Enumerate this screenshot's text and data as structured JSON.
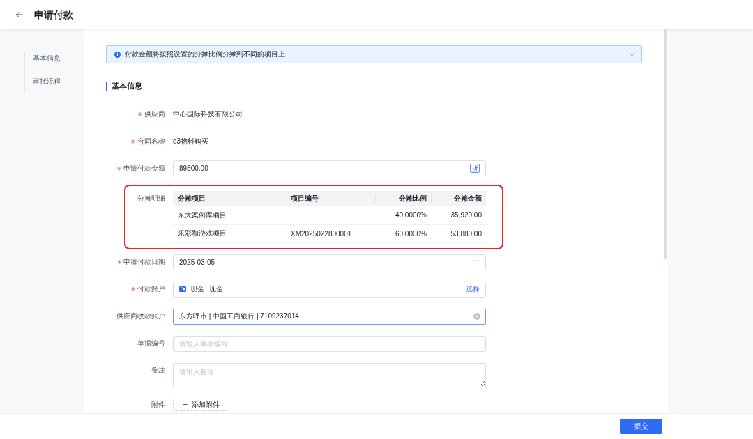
{
  "header": {
    "title": "申请付款"
  },
  "side_nav": {
    "items": [
      {
        "label": "基本信息"
      },
      {
        "label": "审批流程"
      }
    ]
  },
  "alert": {
    "text": "付款金额将按照设置的分摊比例分摊到不同的项目上",
    "closable": true
  },
  "section": {
    "title": "基本信息"
  },
  "fields": [
    {
      "kind": "text",
      "label": "供应商",
      "required": true,
      "value": "中心国际科技有限公司"
    },
    {
      "kind": "text",
      "label": "合同名称",
      "required": true,
      "value": "d3物料购买"
    },
    {
      "kind": "amount",
      "label": "申请付款金额",
      "required": true,
      "value": "89800.00",
      "addon": "折"
    },
    {
      "kind": "table",
      "label": "分摊明细",
      "required": false,
      "highlighted": true,
      "columns": [
        {
          "label": "分摊项目",
          "kind": "text"
        },
        {
          "label": "项目编号",
          "kind": "text"
        },
        {
          "label": "分摊比例",
          "kind": "number"
        },
        {
          "label": "分摊金额",
          "kind": "number"
        }
      ],
      "rows": [
        {
          "project": "东大案例库项目",
          "ratio": "40.0000%",
          "amount": "35,920.00"
        },
        {
          "project": "乐彩和游戏项目",
          "code": "XM2025022800001",
          "ratio": "60.0000%",
          "amount": "53,880.00"
        }
      ]
    },
    {
      "kind": "date",
      "label": "申请付款日期",
      "required": true,
      "value": "2025-03-05"
    },
    {
      "kind": "account",
      "label": "付款账户",
      "required": true,
      "values": [
        "现金",
        "现金"
      ],
      "action": "选择"
    },
    {
      "kind": "select",
      "label": "供应商收款账户",
      "required": false,
      "focused": true,
      "value": "东方呼市 | 中国工商银行 | 7109237014"
    },
    {
      "kind": "input",
      "label": "单据编号",
      "required": false,
      "placeholder": "请输入单据编号"
    },
    {
      "kind": "textarea",
      "label": "备注",
      "required": false,
      "placeholder": "请输入备注"
    },
    {
      "kind": "upload",
      "label": "附件",
      "required": false,
      "button": "添加附件"
    }
  ],
  "footer": {
    "submit": "提交"
  }
}
